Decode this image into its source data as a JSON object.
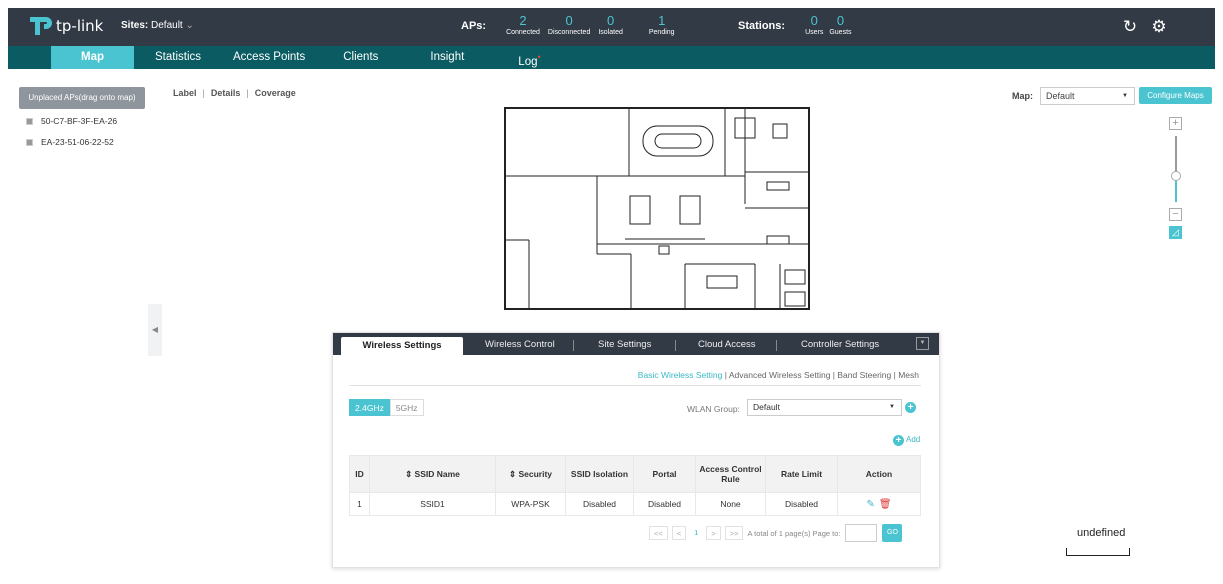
{
  "header": {
    "logo_text": "tp-link",
    "sites_label": "Sites:",
    "sites_value": "Default",
    "aps_label": "APs:",
    "aps": [
      {
        "num": "2",
        "cap": "Connected"
      },
      {
        "num": "0",
        "cap": "Disconnected"
      },
      {
        "num": "0",
        "cap": "Isolated"
      },
      {
        "num": "1",
        "cap": "Pending"
      }
    ],
    "stations_label": "Stations:",
    "stations": [
      {
        "num": "0",
        "cap": "Users"
      },
      {
        "num": "0",
        "cap": "Guests"
      }
    ],
    "refresh_icon": "refresh-icon",
    "settings_icon": "gear-icon"
  },
  "nav": {
    "tabs": [
      "Map",
      "Statistics",
      "Access Points",
      "Clients",
      "Insight",
      "Log"
    ],
    "active": "Map",
    "badge": "•"
  },
  "left": {
    "unplaced_label": "Unplaced APs(drag onto map)",
    "aps": [
      "50-C7-BF-3F-EA-26",
      "EA-23-51-06-22-52"
    ],
    "collapse_icon": "◀"
  },
  "view_links": [
    "Label",
    "Details",
    "Coverage"
  ],
  "map_controls": {
    "map_label": "Map:",
    "map_value": "Default",
    "configure_label": "Configure Maps",
    "zoom_in": "+",
    "zoom_out": "−",
    "zoom_level": 0.4
  },
  "panel": {
    "tabs": [
      "Wireless Settings",
      "Wireless Control",
      "Site Settings",
      "Cloud Access",
      "Controller Settings"
    ],
    "active_tab": "Wireless Settings",
    "sublinks": [
      "Basic Wireless Setting",
      "Advanced Wireless Setting",
      "Band Steering",
      "Mesh"
    ],
    "freq": [
      "2.4GHz",
      "5GHz"
    ],
    "wlan_label": "WLAN Group:",
    "wlan_value": "Default",
    "add_label": "Add",
    "table": {
      "headers": [
        "ID",
        "⇕ SSID Name",
        "⇕ Security",
        "SSID Isolation",
        "Portal",
        "Access Control Rule",
        "Rate Limit",
        "Action"
      ],
      "rows": [
        [
          "1",
          "SSID1",
          "WPA-PSK",
          "Disabled",
          "Disabled",
          "None",
          "Disabled"
        ]
      ]
    },
    "pager": {
      "first": "<<",
      "prev": "<",
      "current": "1",
      "next": ">",
      "last": ">>",
      "summary": "A total of 1 page(s)  Page to:",
      "go": "GO"
    }
  },
  "scale_text": "undefined",
  "colors": {
    "accent": "#4ac4d0",
    "dark": "#323a45",
    "nav": "#0a5c62"
  }
}
